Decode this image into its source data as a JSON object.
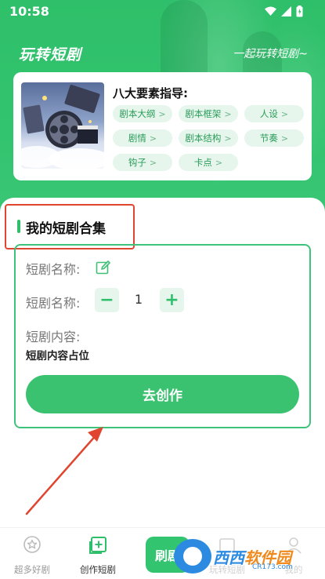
{
  "status": {
    "time": "10:58"
  },
  "header": {
    "title": "玩转短剧",
    "slogan": "一起玩转短剧~"
  },
  "guide": {
    "heading": "八大要素指导:",
    "chips": [
      {
        "label": "剧本大纲"
      },
      {
        "label": "剧本框架"
      },
      {
        "label": "人设"
      },
      {
        "label": "剧情"
      },
      {
        "label": "剧本结构"
      },
      {
        "label": "节奏"
      },
      {
        "label": "钩子"
      },
      {
        "label": "卡点"
      }
    ],
    "chip_arrow": ">"
  },
  "collection": {
    "title": "我的短剧合集",
    "name_label": "短剧名称:",
    "count_label": "短剧名称:",
    "count_value": "1",
    "minus": "−",
    "plus": "+",
    "content_label": "短剧内容:",
    "content_placeholder": "短剧内容占位",
    "create_button": "去创作"
  },
  "tabbar": {
    "tabs": [
      {
        "label": "超多好剧",
        "active": false
      },
      {
        "label": "创作短剧",
        "active": true
      },
      {
        "label": "玩转短剧",
        "active": false
      },
      {
        "label": "我的",
        "active": false
      }
    ],
    "center_label": "刷剧"
  },
  "watermark": {
    "text1": "西西",
    "text2": "软件园",
    "sub": "CR173.com"
  },
  "colors": {
    "primary": "#2fbf6a",
    "chip_bg": "#e6f6ec",
    "highlight": "#e0462f"
  }
}
